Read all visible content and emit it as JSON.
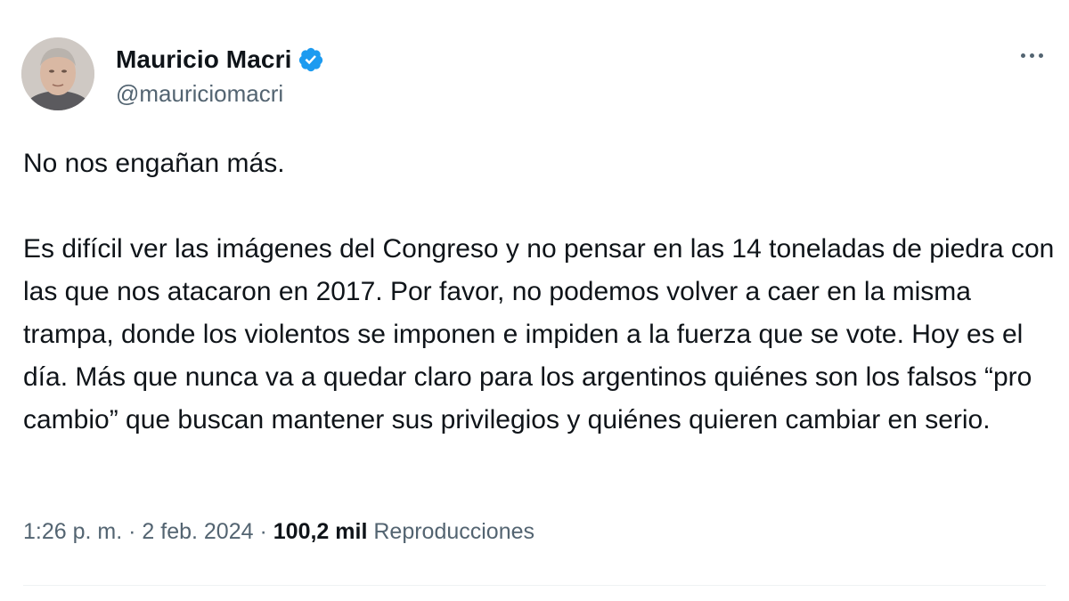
{
  "author": {
    "name": "Mauricio Macri",
    "handle": "@mauriciomacri",
    "verified": true
  },
  "tweet": {
    "paragraphs": [
      "No nos engañan más.",
      "Es difícil ver las imágenes del Congreso y no pensar en las 14 toneladas de piedra con las que nos atacaron en 2017. Por favor, no podemos volver a caer en la misma trampa, donde los violentos se imponen e impiden a la fuerza que se vote. Hoy es el día. Más que nunca va a quedar claro para los argentinos quiénes son los falsos “pro cambio” que buscan mantener sus privilegios y quiénes quieren cambiar en serio."
    ]
  },
  "meta": {
    "time": "1:26 p. m.",
    "date": "2 feb. 2024",
    "separator": "·",
    "views_count": "100,2 mil",
    "views_label": "Reproducciones"
  },
  "icons": {
    "verified": "verified-badge-icon",
    "more": "more-options-icon"
  },
  "colors": {
    "verified_blue": "#1d9bf0",
    "text_primary": "#0f1419",
    "text_secondary": "#536471"
  }
}
